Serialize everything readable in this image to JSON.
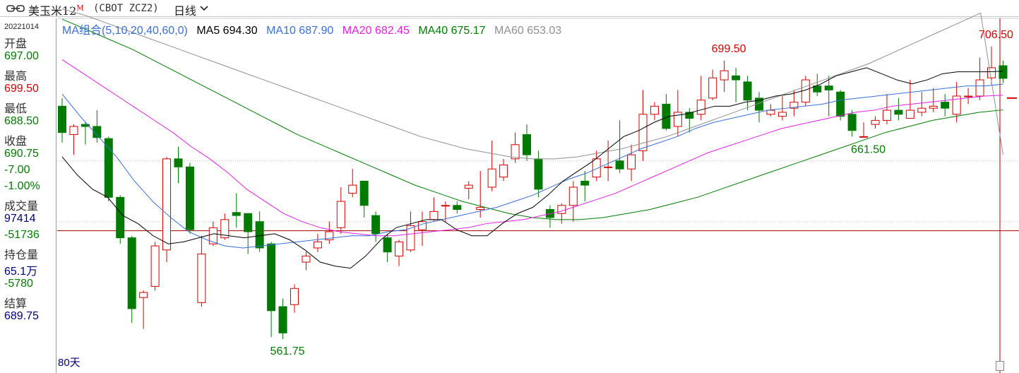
{
  "header": {
    "title": "美玉米12",
    "title_sup": "M",
    "code": "(CBOT ZCZ2)",
    "period": "日线"
  },
  "sidebar": {
    "date": "20221014",
    "items": [
      {
        "label": "开盘",
        "value": "697.00",
        "color": "green"
      },
      {
        "label": "最高",
        "value": "699.50",
        "color": "red"
      },
      {
        "label": "最低",
        "value": "688.50",
        "color": "green"
      },
      {
        "label": "收盘",
        "value": "690.75",
        "color": "green"
      },
      {
        "label": "",
        "value": "-7.00",
        "color": "green"
      },
      {
        "label": "",
        "value": "-1.00%",
        "color": "green"
      },
      {
        "label": "成交量",
        "value": "97414",
        "color": "navy"
      },
      {
        "label": "",
        "value": "-51736",
        "color": "green"
      },
      {
        "label": "持仓量",
        "value": "65.1万",
        "color": "navy"
      },
      {
        "label": "",
        "value": "-5780",
        "color": "green"
      },
      {
        "label": "结算",
        "value": "",
        "color": "navy"
      },
      {
        "label": "",
        "value": "689.75",
        "color": "navy"
      }
    ]
  },
  "legend": {
    "group": "MA组合(5,10,20,40,60,0)",
    "ma5": "MA5 694.30",
    "ma10": "MA10 687.90",
    "ma20": "MA20 682.45",
    "ma40": "MA40 675.17",
    "ma60": "MA60 653.03"
  },
  "footer": {
    "days": "80天"
  },
  "colors": {
    "up": "#d40000",
    "down": "#007a00",
    "ma5": "#000000",
    "ma10": "#3a6fd8",
    "ma20": "#e020e0",
    "ma40": "#007a00",
    "ma60": "#909090",
    "crosshair": "#a00000"
  },
  "chart_data": {
    "type": "candlestick",
    "title": "",
    "ylim": [
      555,
      712
    ],
    "annotations": [
      {
        "text": "699.50",
        "kind": "high"
      },
      {
        "text": "706.50",
        "kind": "high"
      },
      {
        "text": "661.50",
        "kind": "low"
      },
      {
        "text": "561.75",
        "kind": "low"
      }
    ],
    "crosshair_price": 615.5,
    "candles": [
      [
        677.0,
        664.0,
        659.0,
        681.0
      ],
      [
        663.0,
        667.0,
        653.0,
        668.0
      ],
      [
        668.0,
        667.0,
        658.0,
        669.0
      ],
      [
        667.0,
        661.5,
        659.0,
        675.0
      ],
      [
        661.0,
        632.0,
        630.0,
        662.0
      ],
      [
        632.0,
        612.0,
        609.0,
        633.0
      ],
      [
        612.0,
        577.0,
        570.0,
        613.0
      ],
      [
        582.5,
        585.0,
        567.0,
        586.0
      ],
      [
        588.0,
        608.0,
        586.0,
        610.0
      ],
      [
        606.0,
        651.0,
        600.0,
        652.0
      ],
      [
        651.0,
        647.0,
        639.0,
        657.0
      ],
      [
        647.0,
        616.0,
        614.0,
        649.0
      ],
      [
        580.0,
        604.0,
        578.0,
        613.0
      ],
      [
        609.0,
        617.0,
        608.0,
        620.0
      ],
      [
        612.0,
        621.0,
        611.0,
        624.0
      ],
      [
        624.5,
        623.0,
        617.0,
        634.0
      ],
      [
        624.0,
        615.0,
        604.0,
        623.0
      ],
      [
        620.0,
        607.0,
        605.0,
        625.0
      ],
      [
        609.0,
        576.0,
        563.0,
        610.0
      ],
      [
        578.0,
        565.0,
        562.0,
        582.0
      ],
      [
        579.0,
        587.0,
        575.0,
        589.0
      ],
      [
        600.0,
        603.0,
        596.0,
        605.0
      ],
      [
        607.0,
        610.0,
        605.0,
        614.0
      ],
      [
        611.0,
        615.0,
        609.0,
        620.0
      ],
      [
        617.0,
        630.0,
        614.0,
        637.0
      ],
      [
        634.0,
        638.0,
        632.0,
        646.0
      ],
      [
        640.0,
        628.0,
        622.0,
        639.0
      ],
      [
        623.0,
        614.0,
        610.0,
        625.0
      ],
      [
        612.0,
        605.0,
        600.0,
        614.0
      ],
      [
        603.0,
        610.0,
        598.0,
        611.0
      ],
      [
        606.0,
        618.0,
        605.0,
        625.0
      ],
      [
        616.0,
        620.0,
        608.0,
        625.0
      ],
      [
        621.0,
        625.0,
        620.0,
        632.0
      ],
      [
        628.0,
        628.0,
        620.0,
        630.0
      ],
      [
        628.0,
        626.0,
        624.0,
        630.0
      ],
      [
        636.5,
        638.0,
        631.0,
        640.0
      ],
      [
        626.0,
        627.0,
        622.0,
        645.0
      ],
      [
        637.0,
        646.0,
        635.0,
        660.0
      ],
      [
        642.0,
        648.0,
        640.0,
        651.0
      ],
      [
        651.0,
        658.0,
        649.0,
        664.0
      ],
      [
        663.0,
        653.0,
        650.0,
        668.0
      ],
      [
        651.0,
        636.0,
        632.0,
        655.0
      ],
      [
        626.0,
        622.0,
        617.0,
        628.0
      ],
      [
        624.0,
        628.0,
        619.0,
        629.0
      ],
      [
        628.0,
        637.0,
        620.0,
        640.0
      ],
      [
        640.0,
        638.0,
        630.0,
        645.0
      ],
      [
        642.0,
        651.0,
        640.0,
        655.0
      ],
      [
        647.0,
        647.0,
        640.0,
        660.0
      ],
      [
        650.0,
        646.0,
        644.0,
        670.0
      ],
      [
        646.0,
        653.0,
        640.0,
        658.0
      ],
      [
        655.0,
        673.0,
        650.0,
        685.0
      ],
      [
        673.0,
        677.0,
        670.0,
        679.0
      ],
      [
        678.0,
        666.0,
        665.0,
        683.0
      ],
      [
        667.0,
        674.0,
        662.0,
        685.0
      ],
      [
        674.0,
        671.0,
        664.0,
        676.0
      ],
      [
        673.0,
        680.0,
        670.0,
        692.0
      ],
      [
        681.0,
        691.0,
        680.0,
        695.0
      ],
      [
        690.0,
        694.5,
        684.0,
        699.5
      ],
      [
        692.0,
        690.0,
        679.0,
        696.0
      ],
      [
        689.0,
        680.0,
        675.0,
        692.0
      ],
      [
        681.0,
        675.0,
        669.0,
        684.0
      ],
      [
        673.0,
        675.0,
        672.0,
        678.0
      ],
      [
        672.0,
        674.0,
        670.0,
        682.0
      ],
      [
        676.0,
        679.0,
        672.0,
        685.0
      ],
      [
        679.0,
        690.0,
        677.0,
        692.0
      ],
      [
        687.0,
        684.0,
        682.0,
        693.0
      ],
      [
        687.0,
        685.0,
        672.0,
        692.0
      ],
      [
        684.0,
        672.0,
        670.0,
        685.0
      ],
      [
        673.0,
        665.0,
        662.0,
        675.0
      ],
      [
        662.0,
        662.0,
        661.5,
        669.0
      ],
      [
        668.0,
        670.0,
        666.0,
        672.0
      ],
      [
        670.0,
        675.0,
        668.0,
        683.0
      ],
      [
        675.0,
        673.0,
        670.0,
        681.0
      ],
      [
        671.0,
        675.0,
        671.0,
        690.0
      ],
      [
        674.0,
        676.0,
        672.0,
        684.0
      ],
      [
        676.0,
        677.0,
        674.0,
        686.0
      ],
      [
        679.0,
        676.0,
        672.0,
        683.0
      ],
      [
        673.0,
        682.0,
        669.0,
        689.0
      ],
      [
        682.0,
        682.0,
        678.0,
        686.0
      ],
      [
        682.0,
        690.0,
        680.0,
        701.0
      ],
      [
        691.0,
        696.0,
        688.0,
        706.5
      ],
      [
        697.0,
        690.75,
        688.5,
        699.5
      ]
    ],
    "ma5": [
      652,
      643,
      636,
      632,
      623,
      619,
      613,
      609,
      610,
      612,
      614,
      613,
      612,
      613,
      614,
      611,
      606,
      600,
      598,
      597,
      603,
      611,
      617,
      619,
      621,
      621,
      616,
      613,
      613,
      619,
      624,
      627,
      633,
      640,
      645,
      650,
      656,
      662,
      665,
      669,
      672,
      673,
      675,
      677,
      677,
      679,
      680,
      682,
      683,
      685,
      688,
      692,
      694,
      696,
      693,
      690,
      688,
      690,
      693,
      694,
      694,
      694,
      694.3
    ],
    "ma10": [
      683,
      672,
      662,
      652,
      640,
      630,
      622,
      615,
      611,
      608,
      607,
      608,
      609,
      610,
      611,
      612,
      613,
      613,
      615,
      616,
      619,
      621,
      623,
      625,
      627,
      630,
      633,
      637,
      641,
      644,
      648,
      652,
      656,
      659,
      662,
      666,
      669,
      671,
      673,
      675,
      676,
      677,
      678,
      680,
      681,
      682,
      683,
      684,
      685,
      686,
      687,
      687,
      687.9
    ],
    "ma20": [
      700,
      694,
      688,
      682,
      676,
      670,
      664,
      657,
      651,
      644,
      636,
      630,
      624,
      620,
      617,
      615,
      614,
      613,
      613,
      614,
      615,
      616,
      617,
      619,
      620,
      621,
      623,
      625,
      628,
      631,
      634,
      638,
      642,
      646,
      650,
      654,
      657,
      660,
      663,
      666,
      668,
      670,
      672,
      674,
      675,
      677,
      678,
      679,
      680,
      681,
      682,
      682.45
    ],
    "ma40": [
      720,
      715,
      710,
      705,
      699,
      693,
      687,
      681,
      675,
      669,
      663,
      658,
      653,
      648,
      643,
      638,
      634,
      630,
      627,
      624,
      622,
      621,
      621,
      622,
      624,
      626,
      629,
      632,
      636,
      640,
      644,
      648,
      652,
      656,
      660,
      664,
      667,
      670,
      672,
      674,
      675.17
    ],
    "ma60": [
      725,
      722,
      718,
      714,
      710,
      706,
      702,
      698,
      694,
      690,
      686,
      682,
      678,
      674,
      670,
      666,
      662,
      659,
      656,
      654,
      652,
      651,
      651,
      652,
      654,
      656,
      659,
      662,
      666,
      670,
      674,
      678,
      682,
      686,
      690,
      694,
      698,
      703,
      708,
      713,
      718,
      723,
      653.03
    ]
  }
}
